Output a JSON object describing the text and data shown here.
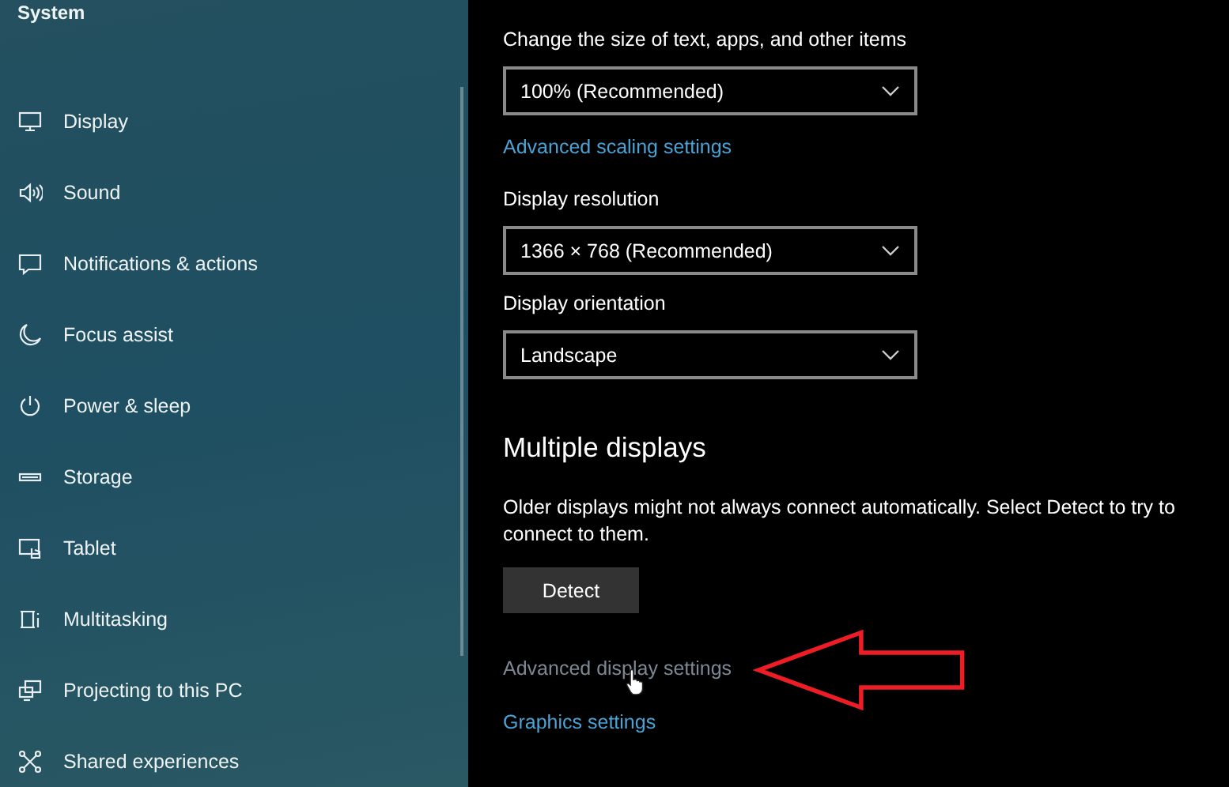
{
  "sidebar": {
    "title": "System",
    "items": [
      {
        "label": "Display"
      },
      {
        "label": "Sound"
      },
      {
        "label": "Notifications & actions"
      },
      {
        "label": "Focus assist"
      },
      {
        "label": "Power & sleep"
      },
      {
        "label": "Storage"
      },
      {
        "label": "Tablet"
      },
      {
        "label": "Multitasking"
      },
      {
        "label": "Projecting to this PC"
      },
      {
        "label": "Shared experiences"
      }
    ]
  },
  "content": {
    "scale": {
      "label": "Change the size of text, apps, and other items",
      "value": "100% (Recommended)"
    },
    "scaling_link": {
      "label": "Advanced scaling settings",
      "hovered": false
    },
    "resolution": {
      "label": "Display resolution",
      "value": "1366 × 768 (Recommended)"
    },
    "orientation": {
      "label": "Display orientation",
      "value": "Landscape"
    },
    "multiple_displays": {
      "heading": "Multiple displays",
      "description": "Older displays might not always connect automatically. Select Detect to try to connect to them.",
      "button": "Detect"
    },
    "links": [
      {
        "label": "Advanced display settings",
        "hovered": true
      },
      {
        "label": "Graphics settings",
        "hovered": false
      }
    ]
  }
}
